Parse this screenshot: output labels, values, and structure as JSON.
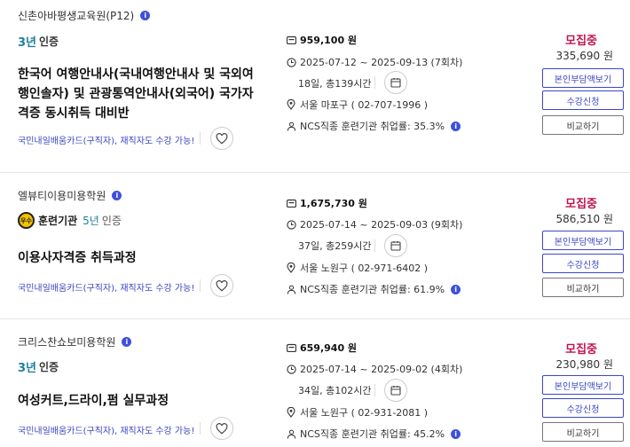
{
  "courses": [
    {
      "org": "신촌아바평생교육원(P12)",
      "cert_years": "3년",
      "cert_label": "인증",
      "title": "한국어 여행안내사(국내여행안내사 및 국외여행인솔자) 및 관광통역안내사(외국어) 국가자격증 동시취득 대비반",
      "card_tag": "국민내일배움카드(구직자), 재직자도 수강 가능!",
      "price": "959,100 원",
      "period": "2025-07-12 ~ 2025-09-13 (7회차)",
      "duration": "18일, 총139시간",
      "location": "서울 마포구 ( 02-707-1996 )",
      "employment": "NCS직종 훈련기관 취업률: 35.3%",
      "status": "모집중",
      "self_pay": "335,690 원",
      "btn_self": "본인부담액보기",
      "btn_apply": "수강신청",
      "btn_compare": "비교하기"
    },
    {
      "org": "엘뷰티이용미용학원",
      "seal_text": "우수",
      "cert_name": "훈련기관",
      "cert_years": "5년",
      "cert_label": "인증",
      "title": "이용사자격증 취득과정",
      "card_tag": "국민내일배움카드(구직자), 재직자도 수강 가능!",
      "price": "1,675,730 원",
      "period": "2025-07-14 ~ 2025-09-03 (9회차)",
      "duration": "37일, 총259시간",
      "location": "서울 노원구 ( 02-971-6402 )",
      "employment": "NCS직종 훈련기관 취업률: 61.9%",
      "status": "모집중",
      "self_pay": "586,510 원",
      "btn_self": "본인부담액보기",
      "btn_apply": "수강신청",
      "btn_compare": "비교하기"
    },
    {
      "org": "크리스찬쇼보미용학원",
      "cert_years": "3년",
      "cert_label": "인증",
      "title": "여성커트,드라이,펌 실무과정",
      "card_tag": "국민내일배움카드(구직자), 재직자도 수강 가능!",
      "price": "659,940 원",
      "period": "2025-07-14 ~ 2025-09-02 (4회차)",
      "duration": "34일, 총102시간",
      "location": "서울 노원구 ( 02-931-2081 )",
      "employment": "NCS직종 훈련기관 취업률: 45.2%",
      "status": "모집중",
      "self_pay": "230,980 원",
      "btn_self": "본인부담액보기",
      "btn_apply": "수강신청",
      "btn_compare": "비교하기"
    }
  ],
  "colors": {
    "accent": "#3b47c2",
    "status": "#c0134f",
    "cert": "#1f7fa0"
  },
  "icons": [
    "info-icon",
    "wallet-icon",
    "clock-icon",
    "calendar-icon",
    "pin-icon",
    "person-icon",
    "heart-icon"
  ]
}
